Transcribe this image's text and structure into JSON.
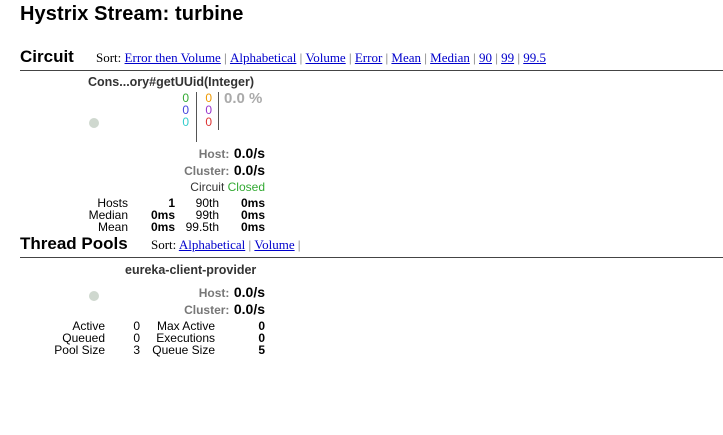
{
  "page": {
    "title": "Hystrix Stream: turbine"
  },
  "circuit_section": {
    "title": "Circuit",
    "sort_label": "Sort:",
    "sort_options": [
      "Error then Volume",
      "Alphabetical",
      "Volume",
      "Error",
      "Mean",
      "Median",
      "90",
      "99",
      "99.5"
    ],
    "card": {
      "name": "Cons...ory#getUUid(Integer)",
      "counts_col1": [
        "0",
        "0",
        "0"
      ],
      "counts_col2": [
        "0",
        "0",
        "0"
      ],
      "error_pct": "0.0 %",
      "host_label": "Host:",
      "host_rate": "0.0/s",
      "cluster_label": "Cluster:",
      "cluster_rate": "0.0/s",
      "circuit_label": "Circuit",
      "circuit_status": "Closed",
      "stats": {
        "hosts_label": "Hosts",
        "hosts_value": "1",
        "median_label": "Median",
        "median_value": "0ms",
        "mean_label": "Mean",
        "mean_value": "0ms",
        "p90_label": "90th",
        "p90_value": "0ms",
        "p99_label": "99th",
        "p99_value": "0ms",
        "p995_label": "99.5th",
        "p995_value": "0ms"
      }
    }
  },
  "threadpool_section": {
    "title": "Thread Pools",
    "sort_label": "Sort:",
    "sort_options": [
      "Alphabetical",
      "Volume"
    ],
    "card": {
      "name": "eureka-client-provider",
      "host_label": "Host:",
      "host_rate": "0.0/s",
      "cluster_label": "Cluster:",
      "cluster_rate": "0.0/s",
      "stats": {
        "active_label": "Active",
        "active_value": "0",
        "queued_label": "Queued",
        "queued_value": "0",
        "pool_size_label": "Pool Size",
        "pool_size_value": "3",
        "max_active_label": "Max Active",
        "max_active_value": "0",
        "executions_label": "Executions",
        "executions_value": "0",
        "queue_size_label": "Queue Size",
        "queue_size_value": "5"
      }
    }
  },
  "colors": {
    "success": "#33aa33",
    "short_circuited": "#4444dd",
    "bad_request": "#33cccc",
    "timeout": "#ee9900",
    "rejected": "#9933cc",
    "failure": "#dd3333",
    "circuit_closed": "#33aa33",
    "link": "#0000cc"
  }
}
